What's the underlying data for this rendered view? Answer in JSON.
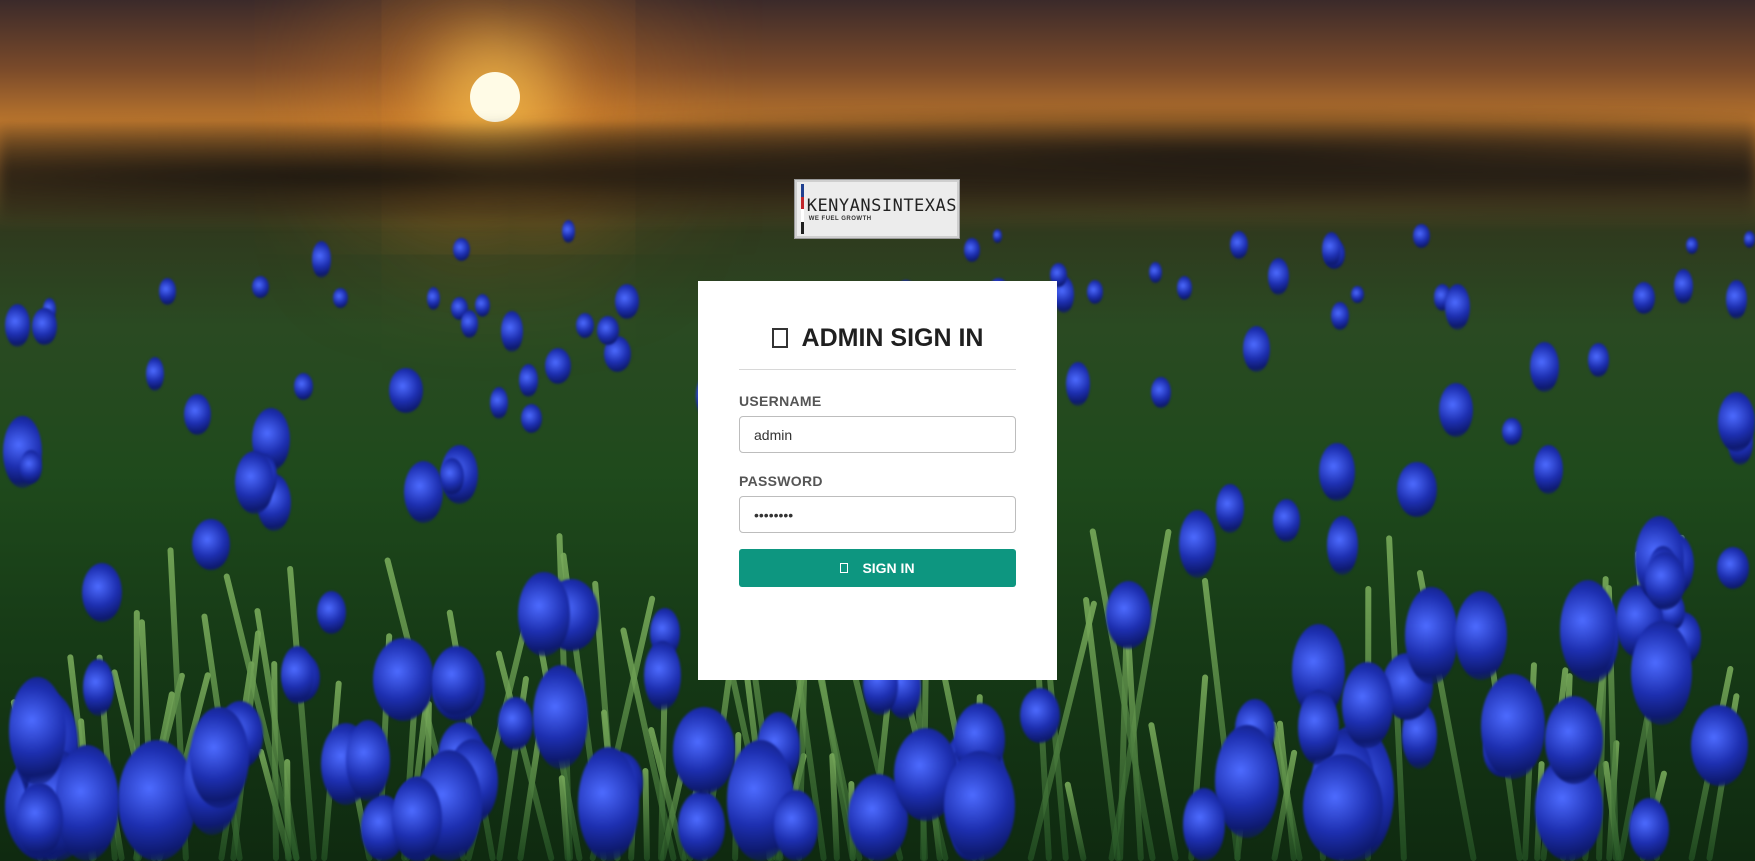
{
  "logo": {
    "title": "KENYANSINTEXAS",
    "tagline": "WE FUEL GROWTH",
    "flag_colors": [
      "#1f3f8f",
      "#c0262b",
      "#ffffff",
      "#1f1f1f"
    ]
  },
  "login": {
    "icon": "lock-icon",
    "title": "ADMIN SIGN IN",
    "username_label": "USERNAME",
    "username_value": "admin",
    "password_label": "PASSWORD",
    "password_value": "••••••••",
    "submit_icon": "sign-in-icon",
    "submit_label": "SIGN IN"
  },
  "colors": {
    "accent": "#0d9680",
    "card_bg": "#ffffff"
  }
}
